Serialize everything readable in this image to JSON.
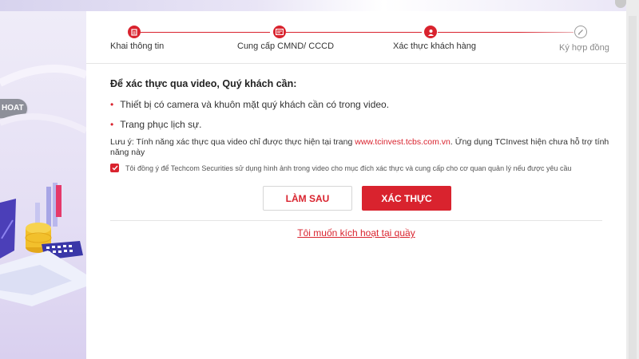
{
  "colors": {
    "accent": "#d9232e",
    "left_panel": "#e4def4",
    "badge": "#8d8f99"
  },
  "left_panel": {
    "badge_text": "HOAT"
  },
  "stepper": {
    "steps": [
      {
        "label": "Khai thông tin",
        "icon": "clipboard-icon",
        "status": "done"
      },
      {
        "label": "Cung cấp CMND/ CCCD",
        "icon": "id-card-icon",
        "status": "done"
      },
      {
        "label": "Xác thực khách hàng",
        "icon": "user-icon",
        "status": "active"
      },
      {
        "label": "Ký hợp đồng",
        "icon": "pen-icon",
        "status": "pending"
      }
    ]
  },
  "content": {
    "heading": "Để xác thực qua video, Quý khách cần:",
    "requirements": [
      "Thiết bị có camera và khuôn mặt quý khách cần có trong video.",
      "Trang phục lịch sự."
    ],
    "note_prefix": "Lưu ý: Tính năng xác thực qua video chỉ được thực hiện tại trang ",
    "note_link": "www.tcinvest.tcbs.com.vn",
    "note_suffix": ". Ứng dụng TCInvest hiện chưa hỗ trợ tính năng này",
    "consent_text": "Tôi đồng ý để Techcom Securities sử dụng hình ảnh trong video cho mục đích xác thực và cung cấp cho cơ quan quản lý nếu được yêu cầu",
    "consent_checked": true
  },
  "actions": {
    "later_label": "LÀM SAU",
    "verify_label": "XÁC THỰC",
    "counter_link": "Tôi muốn kích hoạt tại quầy"
  }
}
